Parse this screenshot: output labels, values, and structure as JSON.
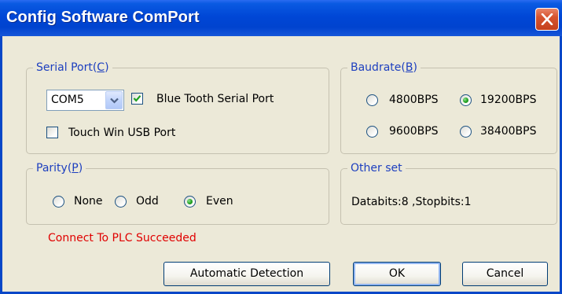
{
  "window": {
    "title": "Config Software ComPort"
  },
  "serial_port": {
    "legend": "Serial Port(",
    "legend_accel": "C",
    "legend_close": ")",
    "com_value": "COM5",
    "bluetooth_label": "Blue Tooth Serial Port",
    "bluetooth_checked": true,
    "usb_label": "Touch Win USB Port",
    "usb_checked": false
  },
  "baudrate": {
    "legend": "Baudrate(",
    "legend_accel": "B",
    "legend_close": ")",
    "options": [
      "4800BPS",
      "19200BPS",
      "9600BPS",
      "38400BPS"
    ],
    "selected": "19200BPS"
  },
  "parity": {
    "legend": "Parity(",
    "legend_accel": "P",
    "legend_close": ")",
    "options": [
      "None",
      "Odd",
      "Even"
    ],
    "selected": "Even"
  },
  "other_set": {
    "legend": "Other set",
    "info": "Databits:8 ,Stopbits:1"
  },
  "status_message": "Connect To PLC Succeeded",
  "buttons": {
    "auto_detect": "Automatic Detection",
    "ok": "OK",
    "cancel": "Cancel"
  },
  "colors": {
    "title_bar": "#0047d6",
    "status_text": "#e00000",
    "legend_text": "#1d3fbf",
    "dialog_bg": "#ece9d8"
  }
}
